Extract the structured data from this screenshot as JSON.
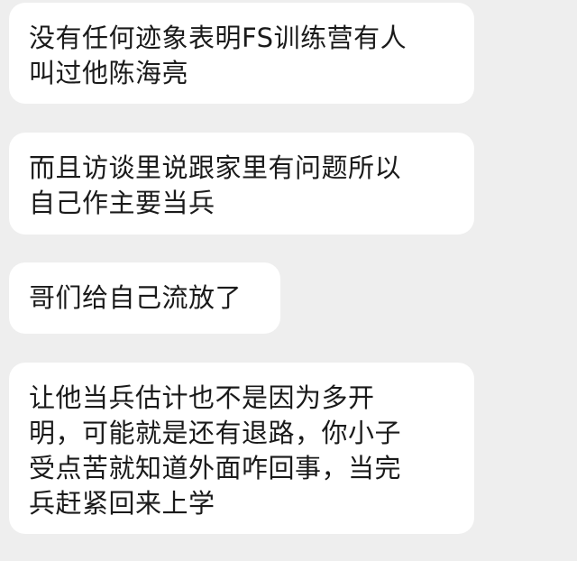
{
  "messages": [
    {
      "lines": [
        "没有任何迹象表明FS训练营有人",
        "叫过他陈海亮"
      ]
    },
    {
      "lines": [
        "而且访谈里说跟家里有问题所以",
        "自己作主要当兵"
      ]
    },
    {
      "lines": [
        "哥们给自己流放了"
      ]
    },
    {
      "lines": [
        "让他当兵估计也不是因为多开",
        "明，可能就是还有退路，你小子",
        "受点苦就知道外面咋回事，当完",
        "兵赶紧回来上学"
      ]
    }
  ],
  "colors": {
    "background": "#eeeeee",
    "bubble": "#ffffff",
    "text": "#1a1a1a"
  }
}
